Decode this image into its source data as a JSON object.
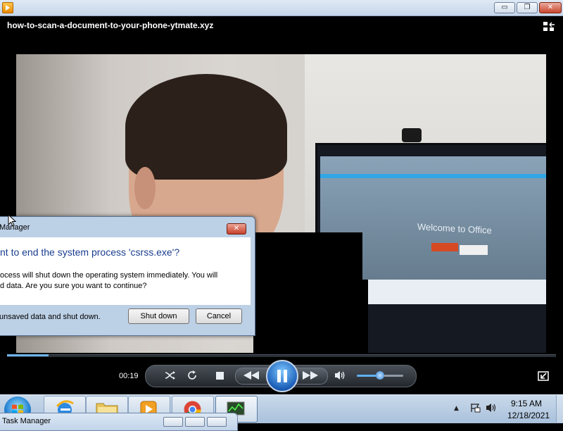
{
  "window": {
    "min_glyph": "▭",
    "max_glyph": "❐",
    "close_glyph": "✕"
  },
  "video": {
    "filename": "how-to-scan-a-document-to-your-phone-ytmate.xyz",
    "screen_text": "Welcome to Office"
  },
  "dialog": {
    "title": "Manager",
    "close_glyph": "✕",
    "heading": "nt to end the system process 'csrss.exe'?",
    "message_line1": "ocess will shut down the operating system immediately.  You will",
    "message_line2": "d data.  Are you sure you want to continue?",
    "footer_text": "unsaved data and shut down.",
    "shutdown_label": "Shut down",
    "cancel_label": "Cancel"
  },
  "player": {
    "elapsed": "00:19",
    "progress_fraction": 0.075,
    "volume_fraction": 0.5,
    "icons": [
      "shuffle-icon",
      "repeat-icon",
      "stop-icon",
      "previous-icon",
      "pause-icon",
      "next-icon",
      "volume-icon",
      "switch-to-library-icon"
    ]
  },
  "taskbar": {
    "time": "9:15 AM",
    "date": "12/18/2021",
    "tray_arrow": "▲",
    "peek_window_title": "Task Manager",
    "items": [
      "start-button",
      "internet-explorer",
      "windows-explorer",
      "windows-media-player",
      "google-chrome",
      "task-manager"
    ]
  },
  "colors": {
    "accent_blue": "#1b5eb8",
    "dialog_heading": "#1a3d8f",
    "close_red": "#c7402a",
    "seek_fill": "#6fb4ea"
  }
}
